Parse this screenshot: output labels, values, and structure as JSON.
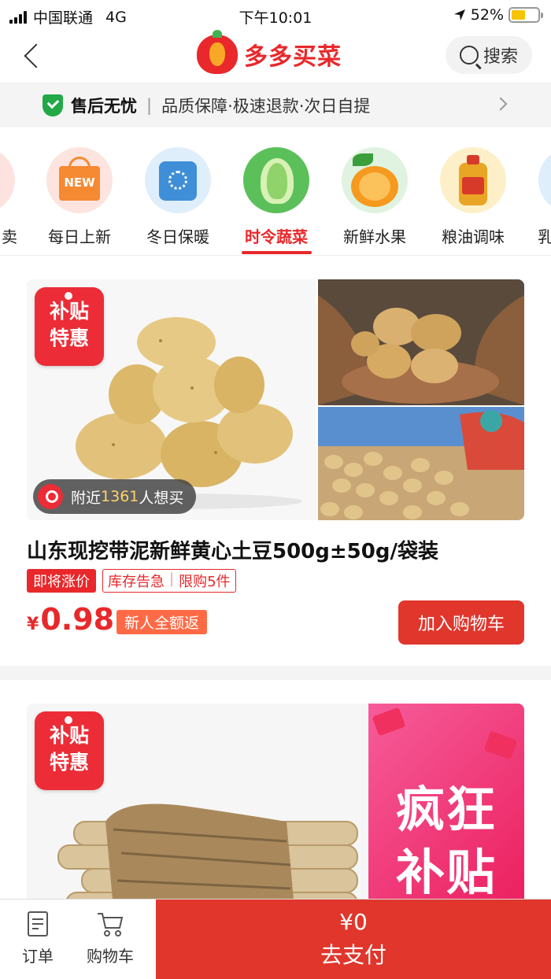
{
  "status_bar": {
    "carrier": "中国联通",
    "network": "4G",
    "time": "下午10:01",
    "battery": "52%",
    "battery_level": 0.52
  },
  "nav": {
    "title": "多多买菜",
    "search_label": "搜索",
    "icons": [
      "back-icon",
      "logo-icon",
      "search-icon"
    ]
  },
  "guarantee": {
    "title": "售后无忧",
    "separator": "|",
    "text": "品质保障·极速退款·次日自提"
  },
  "categories": [
    {
      "label": "卖",
      "icon": "partial-icon",
      "active": false
    },
    {
      "label": "每日上新",
      "icon": "new-bag-icon",
      "active": false
    },
    {
      "label": "冬日保暖",
      "icon": "sweater-icon",
      "active": false
    },
    {
      "label": "时令蔬菜",
      "icon": "cabbage-icon",
      "active": true
    },
    {
      "label": "新鲜水果",
      "icon": "orange-icon",
      "active": false
    },
    {
      "label": "粮油调味",
      "icon": "oil-icon",
      "active": false
    },
    {
      "label": "乳",
      "icon": "milk-icon",
      "active": false
    }
  ],
  "product1": {
    "badge_line1": "补贴",
    "badge_line2": "特惠",
    "nearby_prefix": "附近",
    "nearby_count": "1361",
    "nearby_suffix": "人想买",
    "title": "山东现挖带泥新鲜黄心土豆500g±50g/袋装",
    "tag_rising": "即将涨价",
    "tag_stock": "库存告急",
    "tag_limit": "限购5件",
    "tag_sep": "|",
    "currency": "¥",
    "price": "0.98",
    "refund_tag": "新人全额返",
    "add_cart": "加入购物车"
  },
  "product2": {
    "badge_line1": "补贴",
    "badge_line2": "特惠",
    "promo_line1": "疯狂",
    "promo_line2": "补贴"
  },
  "bottom_bar": {
    "orders_label": "订单",
    "cart_label": "购物车",
    "pay_amount": "¥0",
    "pay_label": "去支付"
  }
}
